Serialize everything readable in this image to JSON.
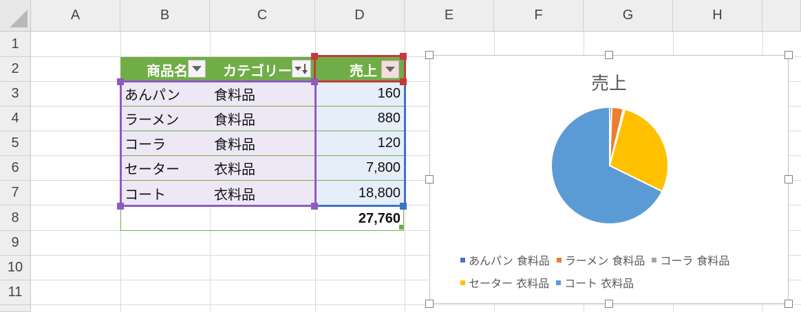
{
  "sheet": {
    "columns": [
      "A",
      "B",
      "C",
      "D",
      "E",
      "F",
      "G",
      "H"
    ],
    "rows": [
      "1",
      "2",
      "3",
      "4",
      "5",
      "6",
      "7",
      "8",
      "9",
      "10",
      "11"
    ]
  },
  "table": {
    "headers": [
      "商品名",
      "カテゴリー",
      "売上"
    ],
    "rows": [
      {
        "name": "あんパン",
        "category": "食料品",
        "sales": "160"
      },
      {
        "name": "ラーメン",
        "category": "食料品",
        "sales": "880"
      },
      {
        "name": "コーラ",
        "category": "食料品",
        "sales": "120"
      },
      {
        "name": "セーター",
        "category": "衣料品",
        "sales": "7,800"
      },
      {
        "name": "コート",
        "category": "衣料品",
        "sales": "18,800"
      }
    ],
    "total": "27,760"
  },
  "chart_data": {
    "type": "pie",
    "title": "売上",
    "categories": [
      "あんパン 食料品",
      "ラーメン 食料品",
      "コーラ 食料品",
      "セーター 衣料品",
      "コート 衣料品"
    ],
    "values": [
      160,
      880,
      120,
      7800,
      18800
    ],
    "colors": [
      "#4472c4",
      "#ed7d31",
      "#a5a5a5",
      "#ffc000",
      "#5b9bd5"
    ],
    "legend_position": "bottom"
  },
  "colors": {
    "header_green": "#70ad47",
    "selection_purple": "#8e5ac1",
    "selection_blue": "#3d74c5",
    "selection_red": "#c43a3a"
  }
}
